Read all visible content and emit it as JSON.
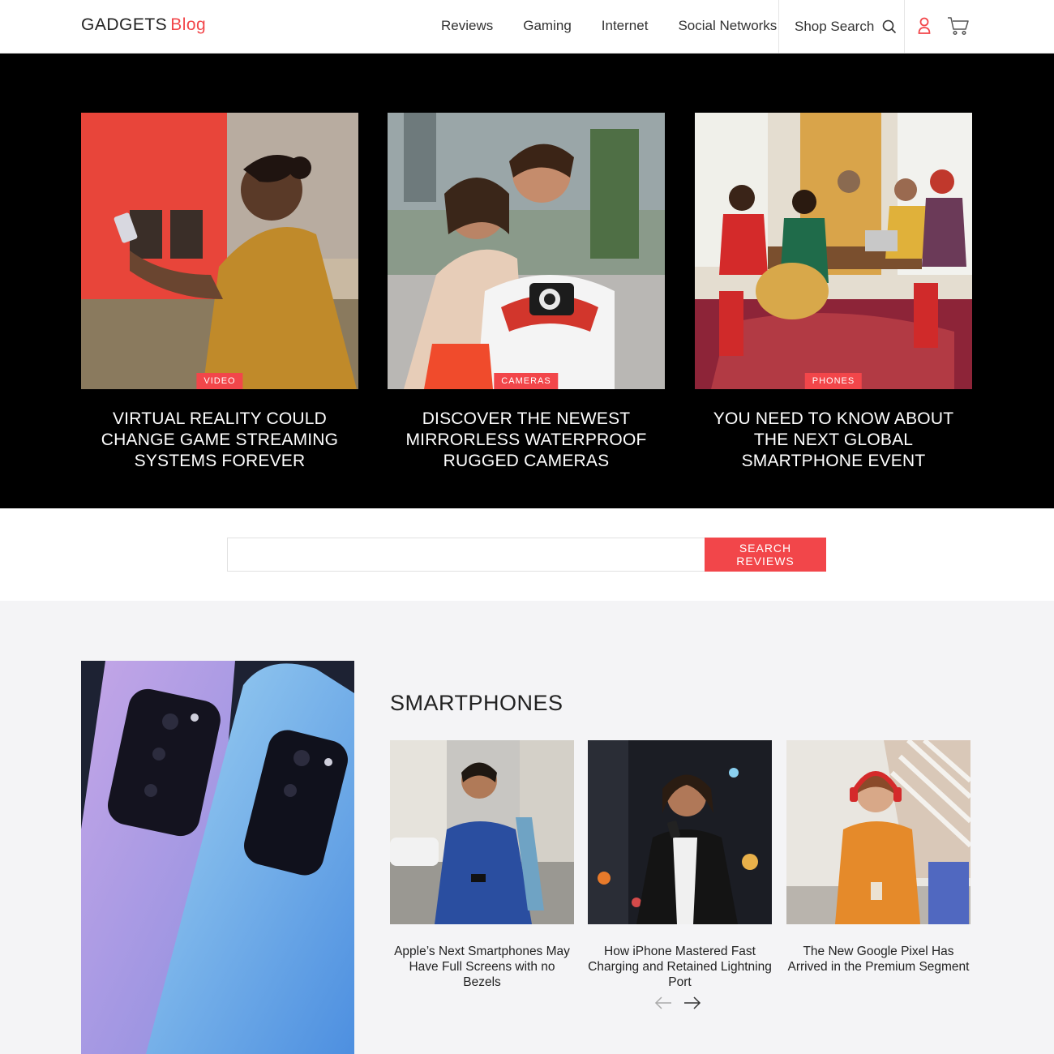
{
  "header": {
    "logo_main": "GADGETS",
    "logo_accent": "Blog",
    "nav": [
      {
        "label": "Reviews"
      },
      {
        "label": "Gaming"
      },
      {
        "label": "Internet"
      },
      {
        "label": "Social Networks"
      }
    ],
    "shop_search_label": "Shop Search",
    "icons": [
      "search-icon",
      "user-icon",
      "cart-icon"
    ]
  },
  "hero": {
    "cards": [
      {
        "badge": "Video",
        "title": "Virtual Reality Could Change Game Streaming Systems Forever"
      },
      {
        "badge": "Cameras",
        "title": "Discover the Newest Mirrorless Waterproof Rugged Cameras"
      },
      {
        "badge": "Phones",
        "title": "You Need to Know About the Next Global Smartphone Event"
      }
    ]
  },
  "search": {
    "placeholder": "",
    "button_label": "Search Reviews"
  },
  "smartphones": {
    "title": "SMARTPHONES",
    "cards": [
      {
        "title": "Apple’s Next Smartphones May Have Full Screens with no Bezels"
      },
      {
        "title": "How iPhone Mastered Fast Charging and Retained Lightning Port"
      },
      {
        "title": "The New Google Pixel Has Arrived in the Premium Segment"
      }
    ]
  },
  "colors": {
    "accent": "#f2464a",
    "hero_bg": "#000000",
    "lower_bg": "#f4f4f6"
  }
}
